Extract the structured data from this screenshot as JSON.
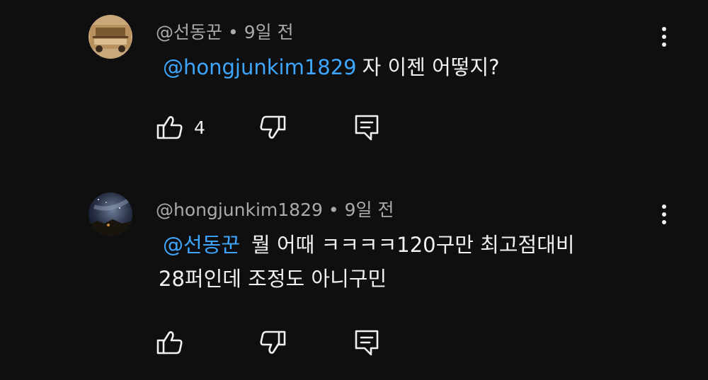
{
  "colors": {
    "background": "#0f0f0f",
    "text": "#f1f1f1",
    "meta": "#aaaaaa",
    "mention": "#3ea6ff"
  },
  "comments": [
    {
      "author": "@선동꾼",
      "separator": "•",
      "time": "9일 전",
      "mention": "@hongjunkim1829",
      "line1": "자 이젠 어떻지?",
      "line2": "",
      "like_count": "4",
      "icons": {
        "like": "thumbs-up-icon",
        "dislike": "thumbs-down-icon",
        "reply": "reply-comment-icon",
        "menu": "more-vert-icon"
      }
    },
    {
      "author": "@hongjunkim1829",
      "separator": "•",
      "time": "9일 전",
      "mention": "@선동꾼",
      "line1": "뭘 어때 ㅋㅋㅋㅋ120구만 최고점대비",
      "line2": "28퍼인데 조정도 아니구민",
      "like_count": "",
      "icons": {
        "like": "thumbs-up-icon",
        "dislike": "thumbs-down-icon",
        "reply": "reply-comment-icon",
        "menu": "more-vert-icon"
      }
    }
  ]
}
